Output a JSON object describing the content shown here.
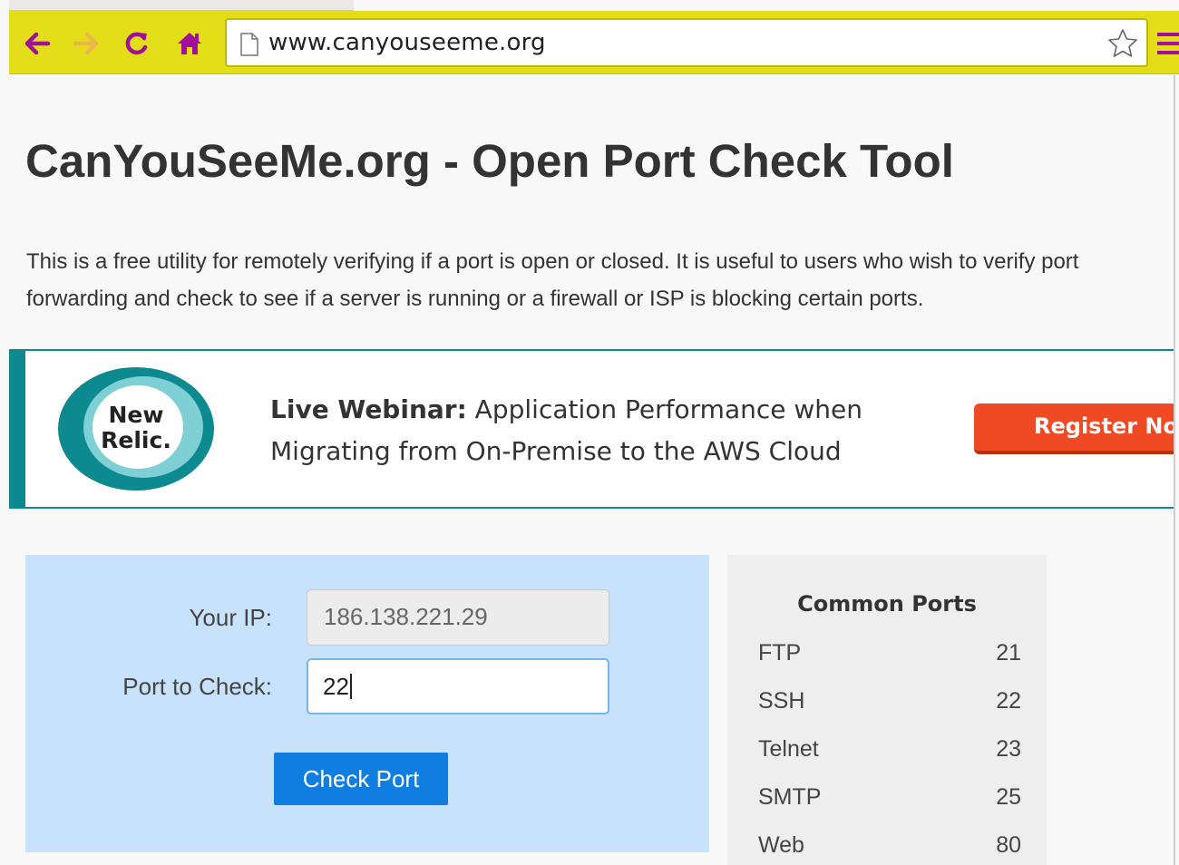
{
  "browser": {
    "url": "www.canyouseeme.org",
    "accent_color": "#e4de1a",
    "icons": [
      "back-icon",
      "forward-icon",
      "reload-icon",
      "home-icon",
      "page-icon",
      "bookmark-star-icon",
      "menu-icon"
    ]
  },
  "page": {
    "title": "CanYouSeeMe.org - Open Port Check Tool",
    "intro_line1": "This is a free utility for remotely verifying if a port is open or closed. It is useful to users who wish to verify port",
    "intro_line2": "forwarding and check to see if a server is running or a firewall or ISP is blocking certain ports."
  },
  "ad": {
    "logo_line1": "New",
    "logo_line2": "Relic.",
    "headline_bold": "Live Webinar:",
    "headline_rest": " Application Performance when",
    "headline_line2": "Migrating from On-Premise to the AWS Cloud",
    "register_label": "Register Now",
    "accent_color": "#0d8a8f",
    "button_color": "#f04a25"
  },
  "form": {
    "ip_label": "Your IP:",
    "ip_value": "186.138.221.29",
    "port_label": "Port to Check:",
    "port_value": "22",
    "button_label": "Check Port",
    "panel_color": "#c9e2fb",
    "button_color": "#0f7ee0"
  },
  "ports": {
    "title": "Common Ports",
    "rows": [
      {
        "name": "FTP",
        "port": "21"
      },
      {
        "name": "SSH",
        "port": "22"
      },
      {
        "name": "Telnet",
        "port": "23"
      },
      {
        "name": "SMTP",
        "port": "25"
      },
      {
        "name": "Web",
        "port": "80"
      }
    ]
  }
}
